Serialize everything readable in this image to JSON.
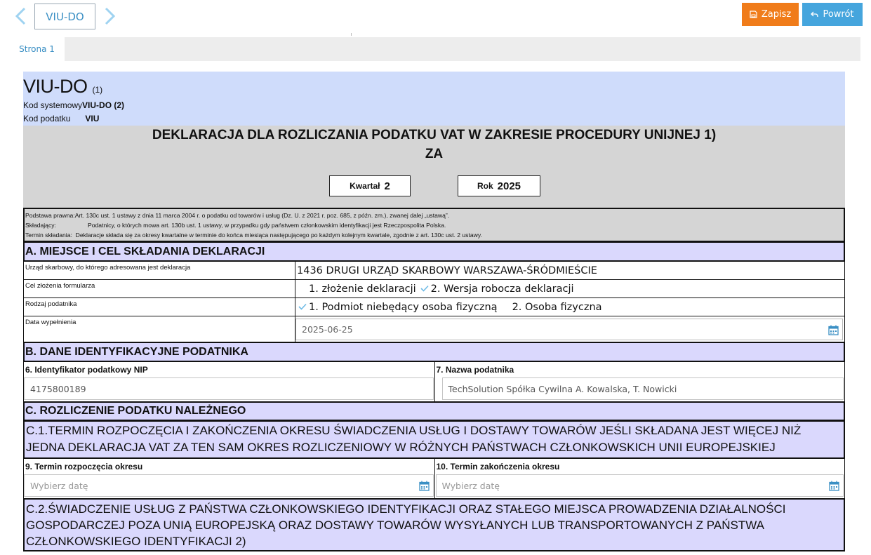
{
  "toolbar": {
    "doc_name": "VIU-DO",
    "save_label": "Zapisz",
    "back_label": "Powrót"
  },
  "tabs": [
    {
      "label": "Strona 1"
    }
  ],
  "form": {
    "title": "VIU-DO",
    "title_version": "(1)",
    "kod_systemowy_label": "Kod systemowy",
    "kod_systemowy_value": "VIU-DO (2)",
    "kod_podatku_label": "Kod podatku",
    "kod_podatku_value": "VIU",
    "declaration_title": "DEKLARACJA DLA ROZLICZANIA PODATKU VAT W ZAKRESIE PROCEDURY UNIJNEJ 1)",
    "declaration_title_2": "ZA",
    "kwartal_label": "Kwartał",
    "kwartal_value": "2",
    "rok_label": "Rok",
    "rok_value": "2025",
    "info": {
      "podstawa_label": "Podstawa prawna:",
      "podstawa_text": "Art. 130c ust. 1 ustawy z dnia 11 marca 2004 r. o podatku od towarów i usług (Dz. U. z 2021 r. poz. 685, z późn. zm.), zwanej dalej „ustawą”.",
      "skladajacy_label": "Składający:",
      "skladajacy_text": "Podatnicy, o których mowa art. 130b ust. 1 ustawy, w przypadku gdy państwem członkowskim identyfikacji jest Rzeczpospolita Polska.",
      "termin_label": "Termin składania:",
      "termin_text": "Deklaracje składa się za okresy kwartalne w terminie do końca miesiąca następującego po każdym kolejnym kwartale, zgodnie z art. 130c ust. 2 ustawy."
    },
    "section_a": {
      "title": "A. MIEJSCE I CEL SKŁADANIA DEKLARACJI",
      "urzad_label": "Urząd skarbowy, do którego adresowana jest deklaracja",
      "urzad_value": "1436  DRUGI URZĄD SKARBOWY WARSZAWA-ŚRÓDMIEŚCIE",
      "cel_label": "Cel złożenia formularza",
      "cel_opt1": "1. złożenie deklaracji",
      "cel_opt2": "2. Wersja robocza deklaracji",
      "rodzaj_label": "Rodzaj podatnika",
      "rodzaj_opt1": "1. Podmiot niebędący osoba fizyczną",
      "rodzaj_opt2": "2. Osoba fizyczna",
      "data_label": "Data wypełnienia",
      "data_value": "2025-06-25"
    },
    "section_b": {
      "title": "B. DANE IDENTYFIKACYJNE PODATNIKA",
      "nip_label": "6. Identyfikator podatkowy NIP",
      "nip_value": "4175800189",
      "nazwa_label": "7. Nazwa podatnika",
      "nazwa_value": "TechSolution Spółka Cywilna A. Kowalska, T. Nowicki"
    },
    "section_c": {
      "title": "C. ROZLICZENIE PODATKU NALEŻNEGO",
      "c1_title": "C.1.TERMIN ROZPOCZĘCIA I ZAKOŃCZENIA OKRESU ŚWIADCZENIA USŁUG I DOSTAWY TOWARÓW JEŚLI SKŁADANA JEST WIĘCEJ NIŻ JEDNA DEKLARACJA VAT ZA TEN SAM OKRES ROZLICZENIOWY W RÓŻNYCH PAŃSTWACH CZŁONKOWSKICH UNII EUROPEJSKIEJ",
      "start_label": "9. Termin rozpoczęcia okresu",
      "start_placeholder": "Wybierz datę",
      "end_label": "10. Termin zakończenia okresu",
      "end_placeholder": "Wybierz datę",
      "c2_title": "C.2.ŚWIADCZENIE USŁUG Z PAŃSTWA CZŁONKOWSKIEGO IDENTYFIKACJI ORAZ STAŁEGO MIEJSCA PROWADZENIA DZIAŁALNOŚCI GOSPODARCZEJ POZA UNIĄ EUROPEJSKĄ ORAZ DOSTAWY TOWARÓW WYSYŁANYCH LUB TRANSPORTOWANYCH Z PAŃSTWA CZŁONKOWSKIEGO IDENTYFIKACJI 2)"
    }
  },
  "colors": {
    "accent_blue": "#45a5dd",
    "save_orange": "#f07c1a",
    "header_blue": "#cfdcfb",
    "section_lavender": "#dad8fd"
  }
}
